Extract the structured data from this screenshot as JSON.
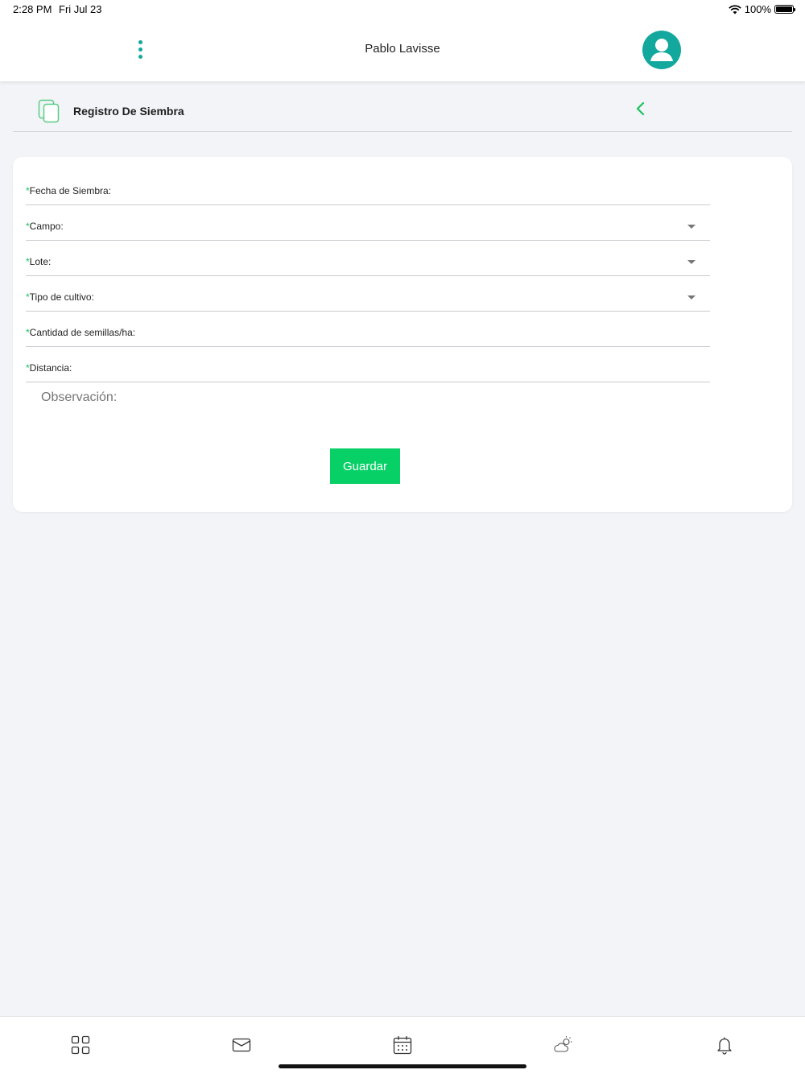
{
  "status_bar": {
    "time": "2:28 PM",
    "date": "Fri Jul 23",
    "battery": "100%"
  },
  "header": {
    "user_name": "Pablo Lavisse"
  },
  "section": {
    "title": "Registro De Siembra"
  },
  "form": {
    "required_mark": "*",
    "fields": [
      {
        "label": "Fecha de Siembra:",
        "type": "text"
      },
      {
        "label": "Campo:",
        "type": "select"
      },
      {
        "label": "Lote:",
        "type": "select"
      },
      {
        "label": "Tipo de cultivo:",
        "type": "select"
      },
      {
        "label": "Cantidad de semillas/ha:",
        "type": "text"
      },
      {
        "label": "Distancia:",
        "type": "text"
      }
    ],
    "observation_placeholder": "Observación:",
    "save_label": "Guardar"
  },
  "colors": {
    "accent_teal": "#12a89d",
    "button_green": "#07d166",
    "required_green": "#1cc15e"
  },
  "bottom_nav": {
    "icons": [
      "grid-icon",
      "mail-icon",
      "calendar-icon",
      "weather-icon",
      "bell-icon"
    ]
  }
}
